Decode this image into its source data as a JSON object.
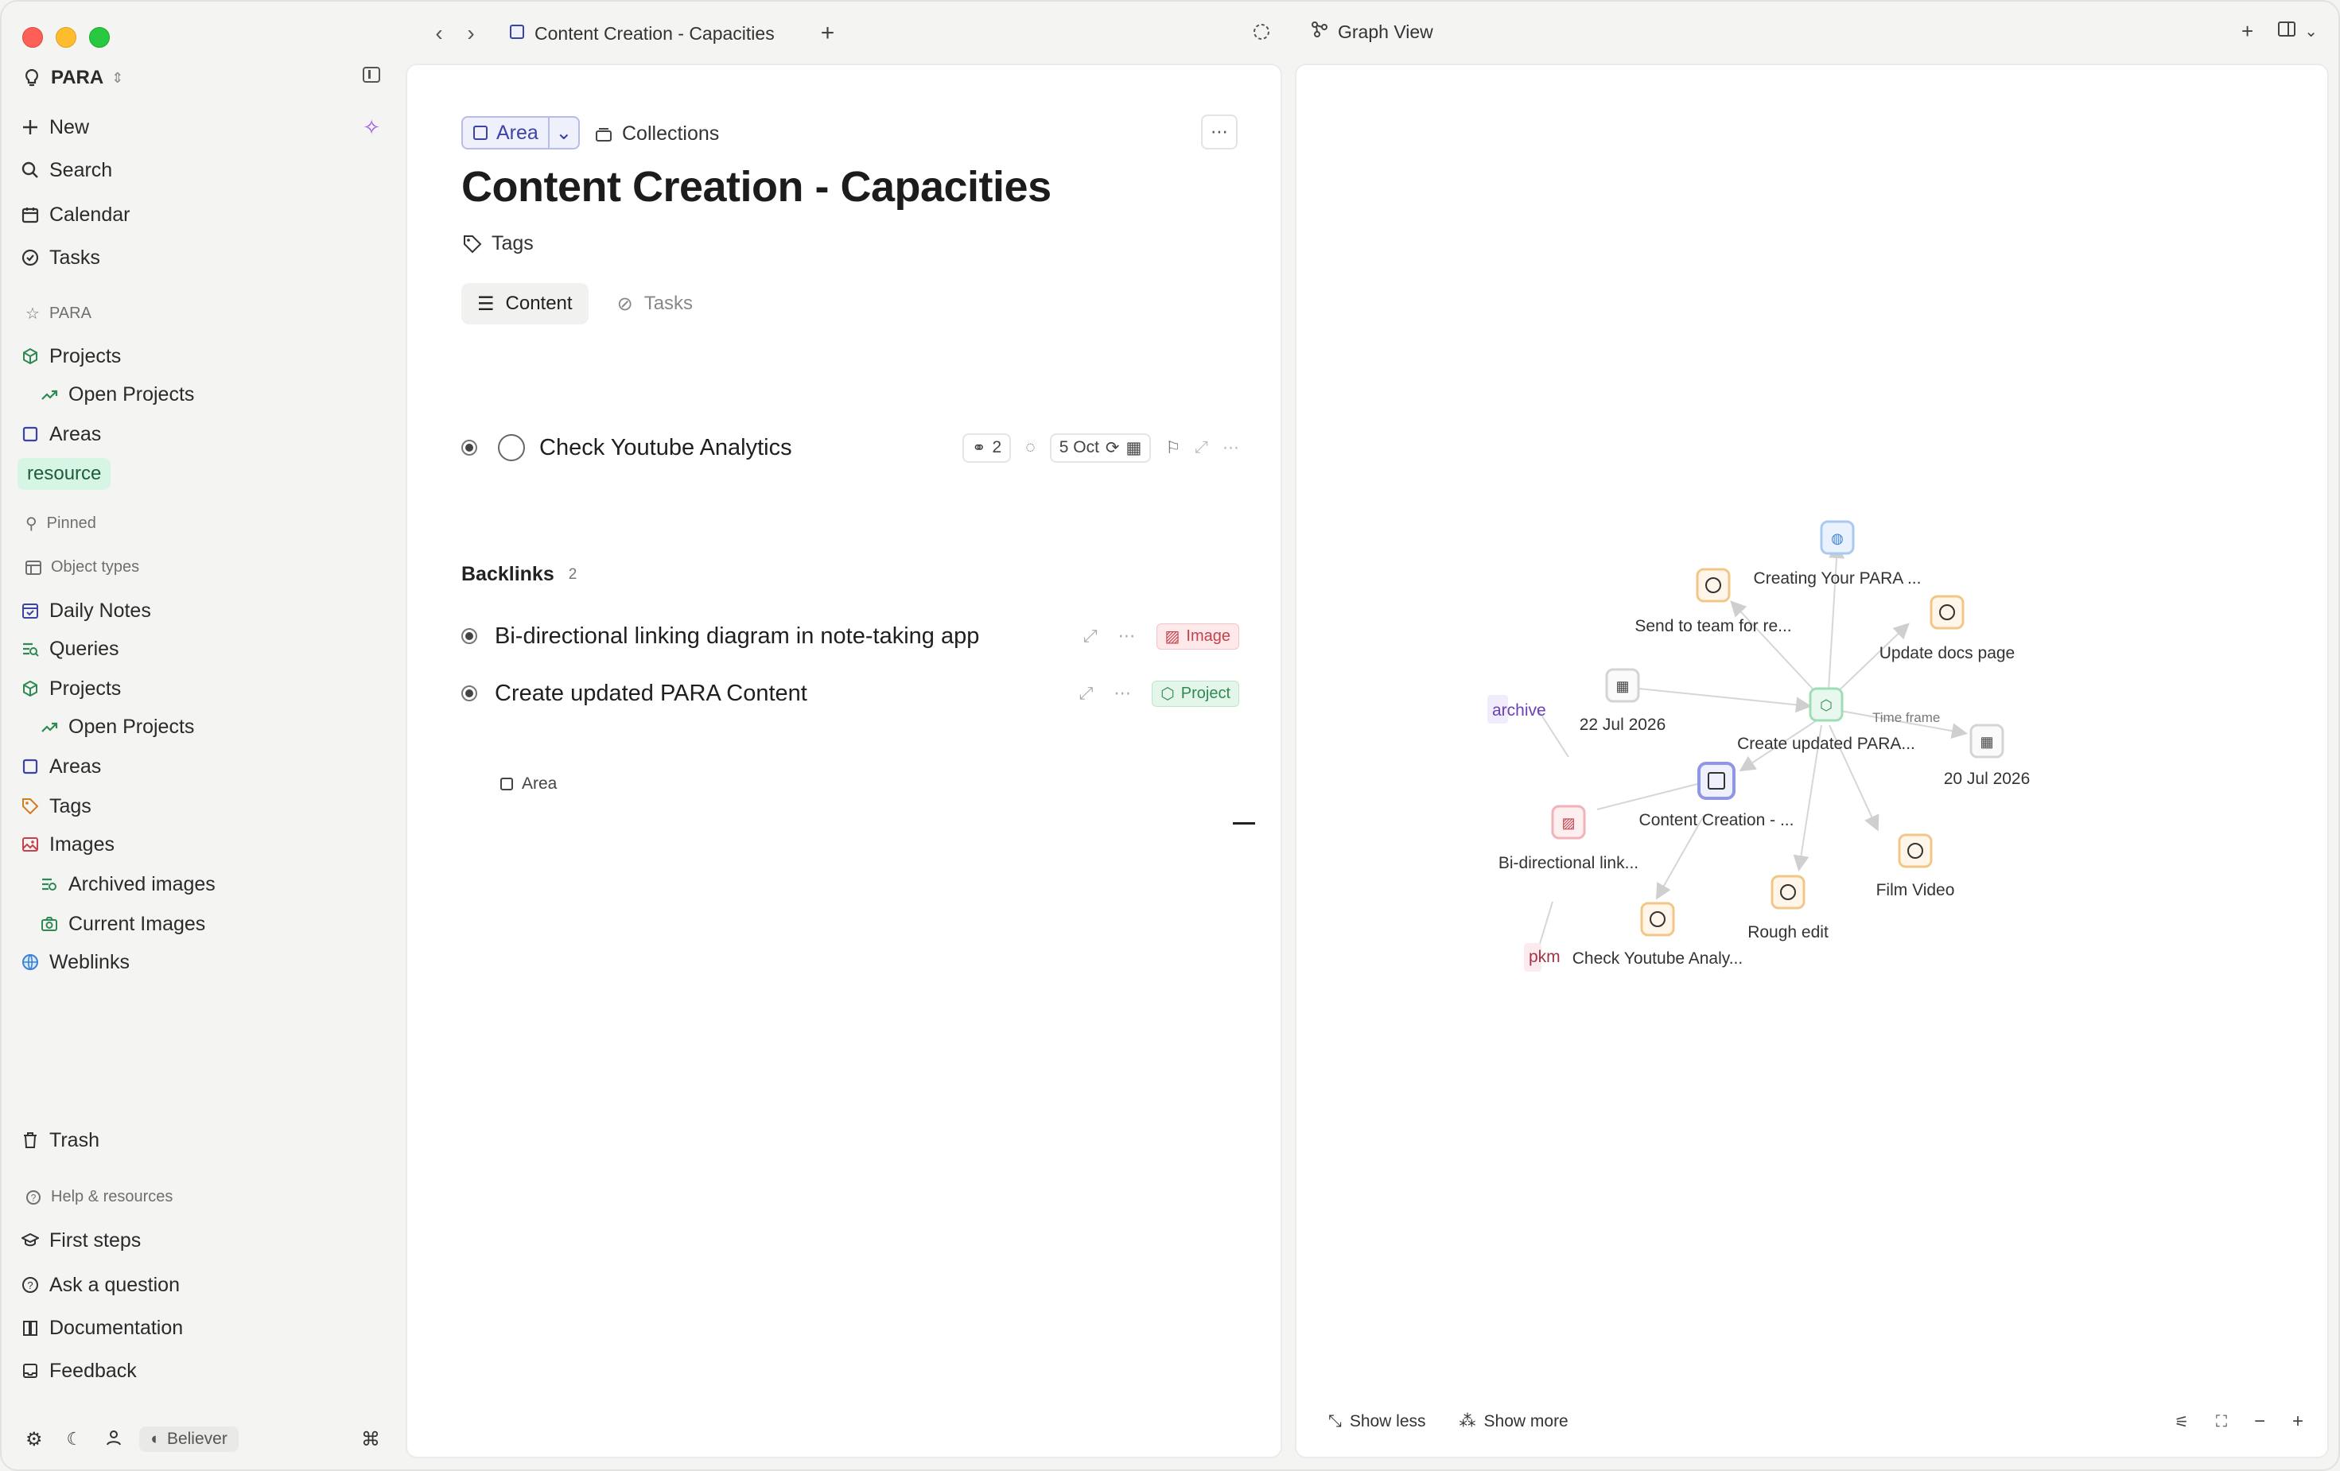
{
  "workspace": {
    "name": "PARA"
  },
  "sidebar": {
    "top": [
      {
        "label": "New"
      },
      {
        "label": "Search"
      },
      {
        "label": "Calendar"
      },
      {
        "label": "Tasks"
      }
    ],
    "para_label": "PARA",
    "para_items": [
      {
        "label": "Projects"
      },
      {
        "label": "Open Projects"
      },
      {
        "label": "Areas"
      }
    ],
    "resource_pill": "resource",
    "pinned_label": "Pinned",
    "object_types_label": "Object types",
    "object_types": [
      {
        "label": "Daily Notes"
      },
      {
        "label": "Queries"
      },
      {
        "label": "Projects"
      },
      {
        "label": "Open Projects"
      },
      {
        "label": "Areas"
      },
      {
        "label": "Tags"
      },
      {
        "label": "Images"
      },
      {
        "label": "Archived images"
      },
      {
        "label": "Current Images"
      },
      {
        "label": "Weblinks"
      }
    ],
    "trash": "Trash",
    "help_label": "Help & resources",
    "help_items": [
      {
        "label": "First steps"
      },
      {
        "label": "Ask a question"
      },
      {
        "label": "Documentation"
      },
      {
        "label": "Feedback"
      }
    ],
    "plan_badge": "Believer"
  },
  "topbar": {
    "tab_title": "Content Creation - Capacities",
    "graph_tab": "Graph View"
  },
  "main": {
    "type_chip": "Area",
    "collections": "Collections",
    "title": "Content Creation - Capacities",
    "tags_label": "Tags",
    "tabs": [
      {
        "label": "Content"
      },
      {
        "label": "Tasks"
      }
    ],
    "task": {
      "title": "Check Youtube Analytics",
      "links_count": "2",
      "date": "5 Oct"
    },
    "backlinks_label": "Backlinks",
    "backlinks_count": "2",
    "backlinks": [
      {
        "title": "Bi-directional linking diagram in note-taking app",
        "badge": "Image"
      },
      {
        "title": "Create updated PARA Content",
        "badge": "Project",
        "sub": "Area"
      }
    ]
  },
  "graph": {
    "nodes": [
      {
        "label": "Creating Your PARA ..."
      },
      {
        "label": "Send to team for re..."
      },
      {
        "label": "Update docs page"
      },
      {
        "label": "22 Jul 2026"
      },
      {
        "label": "Create updated PARA..."
      },
      {
        "label": "20 Jul 2026"
      },
      {
        "label": "archive"
      },
      {
        "label": "Content Creation - ..."
      },
      {
        "label": "Bi-directional link..."
      },
      {
        "label": "Film Video"
      },
      {
        "label": "Rough edit"
      },
      {
        "label": "Check Youtube Analy..."
      },
      {
        "label": "pkm"
      }
    ],
    "edge_label": "Time frame",
    "show_less": "Show less",
    "show_more": "Show more"
  },
  "colors": {
    "area": "#3c43a6",
    "project": "#2d8a52",
    "image": "#c7404c",
    "task": "#e8a24a",
    "weblink": "#3a82d6"
  }
}
